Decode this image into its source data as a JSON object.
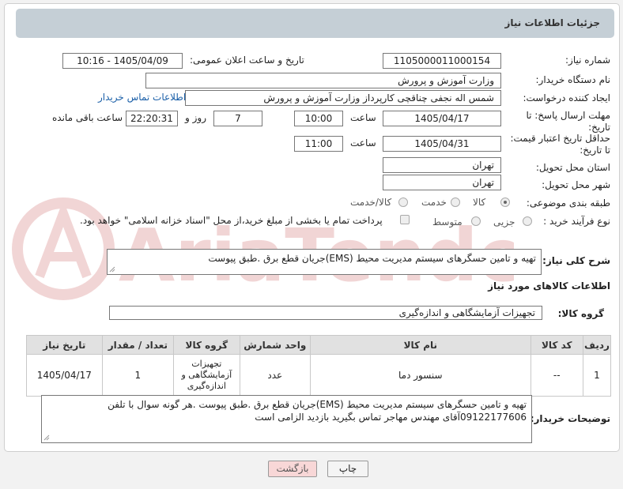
{
  "header": {
    "title": "جزئیات اطلاعات نیاز"
  },
  "fields": {
    "need_number_label": "شماره نیاز:",
    "need_number": "1105000011000154",
    "announce_label": "تاریخ و ساعت اعلان عمومی:",
    "announce_value": "1405/04/09 - 10:16",
    "buyer_org_label": "نام دستگاه خریدار:",
    "buyer_org": "وزارت آموزش و پرورش",
    "creator_label": "ایجاد کننده درخواست:",
    "creator": "شمس اله نجفی چناقچی کارپرداز وزارت آموزش و پرورش",
    "contact_link": "اطلاعات تماس خریدار",
    "deadline_label": "مهلت ارسال پاسخ: تا تاریخ:",
    "deadline_date": "1405/04/17",
    "time_label": "ساعت",
    "deadline_time": "10:00",
    "days_value": "7",
    "days_label": "روز و",
    "remaining_time": "22:20:31",
    "remaining_label": "ساعت باقی مانده",
    "validity_label": "حداقل تاریخ اعتبار قیمت: تا تاریخ:",
    "validity_date": "1405/04/31",
    "validity_time": "11:00",
    "province_label": "استان محل تحویل:",
    "province": "تهران",
    "city_label": "شهر محل تحویل:",
    "city": "تهران",
    "category_label": "طبقه بندی موضوعی:",
    "category_options": [
      "کالا",
      "خدمت",
      "کالا/خدمت"
    ],
    "process_label": "نوع فرآیند خرید :",
    "process_options": [
      "جزیی",
      "متوسط"
    ],
    "payment_note": "پرداخت تمام یا بخشی از مبلغ خرید،از محل \"اسناد خزانه اسلامی\" خواهد بود."
  },
  "description": {
    "label": "شرح کلی نیاز:",
    "text": "تهیه و تامین حسگرهای سیستم مدیریت محیط (EMS)جریان قطع برق .طبق پیوست"
  },
  "goods_info": {
    "heading": "اطلاعات کالاهای مورد نیاز"
  },
  "goods_group": {
    "label": "گروه کالا:",
    "value": "تجهیزات آزمایشگاهی و اندازه‌گیری"
  },
  "table": {
    "headers": [
      "ردیف",
      "کد کالا",
      "نام کالا",
      "واحد شمارش",
      "گروه کالا",
      "تعداد / مقدار",
      "تاریخ نیاز"
    ],
    "rows": [
      {
        "row": "1",
        "code": "--",
        "name": "سنسور دما",
        "unit": "عدد",
        "group": "تجهیزات آزمایشگاهی و اندازه‌گیری",
        "qty": "1",
        "date": "1405/04/17"
      }
    ]
  },
  "buyer_notes": {
    "label": "توضیحات خریدار:",
    "text": "تهیه و تامین حسگرهای سیستم مدیریت محیط (EMS)جریان قطع برق .طبق پیوست .هر گونه سوال با تلفن 09122177606آقای مهندس مهاجر تماس بگیرید بازدید الزامی است"
  },
  "buttons": {
    "print": "چاپ",
    "back": "بازگشت"
  },
  "watermark": {
    "text": "AriaTender.net"
  },
  "colors": {
    "header_bg": "#c5cfd6",
    "link": "#1a5fa8",
    "back_button_bg": "#f8d7d7",
    "watermark": "#e7b3b3"
  }
}
